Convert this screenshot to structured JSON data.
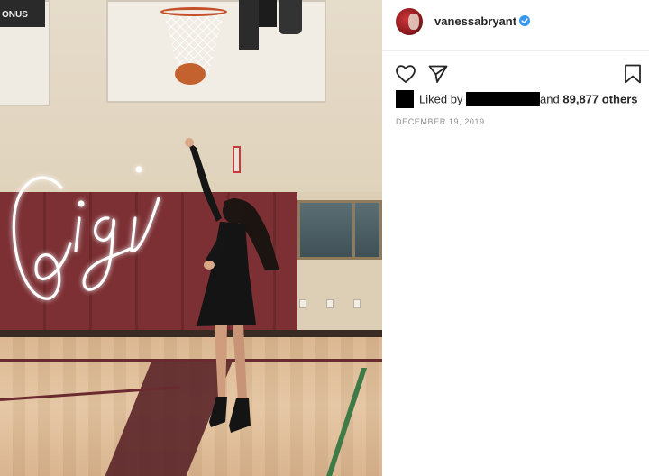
{
  "photo": {
    "scoreboard_text": "ONUS",
    "overlay_text": "Gigi"
  },
  "post": {
    "username": "vanessabryant",
    "verified": true,
    "liked_by_prefix": "Liked by",
    "liked_by_suffix": "and",
    "likes_count": "89,877 others",
    "date": "DECEMBER 19, 2019"
  },
  "icons": {
    "like": "heart-icon",
    "share": "paper-plane-icon",
    "save": "bookmark-icon",
    "verified": "verified-badge-icon"
  },
  "colors": {
    "verified_blue": "#3897f0",
    "text_primary": "#262626",
    "text_secondary": "#8e8e8e"
  }
}
